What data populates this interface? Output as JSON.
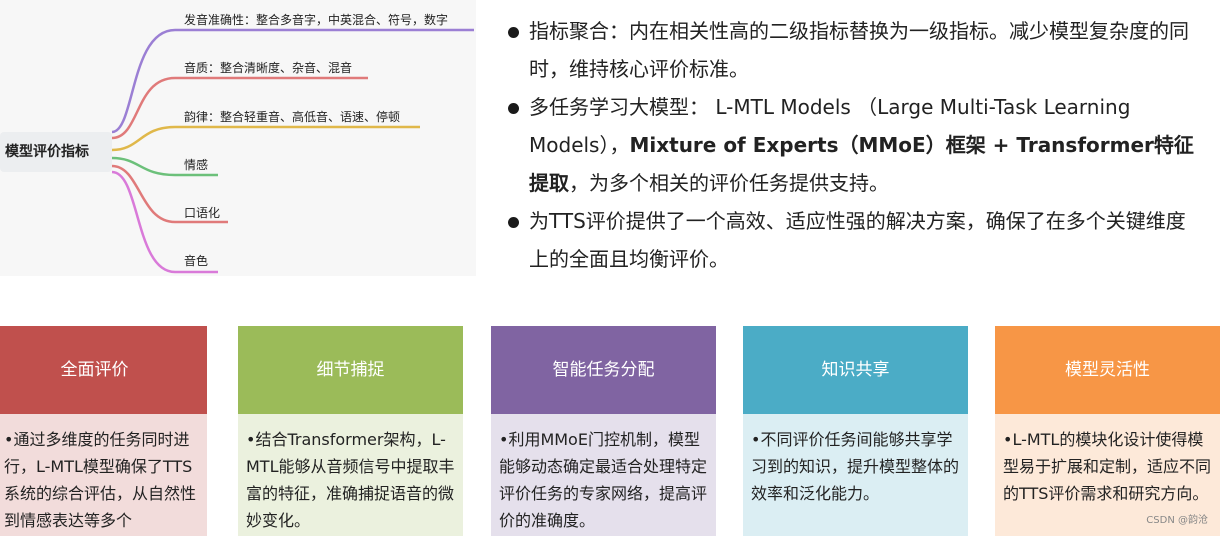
{
  "mindmap": {
    "root": "模型评价指标",
    "branches": [
      {
        "label": "发音准确性：整合多音字，中英混合、符号，数字",
        "color": "#9b7fd4"
      },
      {
        "label": "音质：整合清晰度、杂音、混音",
        "color": "#e07a7a"
      },
      {
        "label": "韵律：整合轻重音、高低音、语速、停顿",
        "color": "#e0b84a"
      },
      {
        "label": "情感",
        "color": "#6cc07a"
      },
      {
        "label": "口语化",
        "color": "#e07a7a"
      },
      {
        "label": "音色",
        "color": "#d97ad9"
      }
    ]
  },
  "bullets": [
    {
      "text": "指标聚合：内在相关性高的二级指标替换为一级指标。减少模型复杂度的同时，维持核心评价标准。"
    },
    {
      "pre": "多任务学习大模型： L-MTL Models （Large Multi-Task Learning Models），",
      "bold": "Mixture of Experts（MMoE）框架 + Transformer特征提取",
      "post": "，为多个相关的评价任务提供支持。"
    },
    {
      "text": "为TTS评价提供了一个高效、适应性强的解决方案，确保了在多个关键维度上的全面且均衡评价。"
    }
  ],
  "cards": [
    {
      "title": "全面评价",
      "head_color": "#c0504d",
      "body_color": "#f2dcdb",
      "text": "•通过多维度的任务同时进行，L-MTL模型确保了TTS系统的综合评估，从自然性到情感表达等多个"
    },
    {
      "title": "细节捕捉",
      "head_color": "#9bbb59",
      "body_color": "#ebf1de",
      "text": "•结合Transformer架构，L-MTL能够从音频信号中提取丰富的特征，准确捕捉语音的微妙变化。"
    },
    {
      "title": "智能任务分配",
      "head_color": "#8064a2",
      "body_color": "#e5e0ec",
      "text": "•利用MMoE门控机制，模型能够动态确定最适合处理特定评价任务的专家网络，提高评价的准确度。"
    },
    {
      "title": "知识共享",
      "head_color": "#4bacc6",
      "body_color": "#dbeef3",
      "text": "•不同评价任务间能够共享学习到的知识，提升模型整体的效率和泛化能力。"
    },
    {
      "title": "模型灵活性",
      "head_color": "#f79646",
      "body_color": "#fde9d9",
      "text": "•L-MTL的模块化设计使得模型易于扩展和定制，适应不同的TTS评价需求和研究方向。"
    }
  ],
  "watermark": "CSDN @韵沧"
}
